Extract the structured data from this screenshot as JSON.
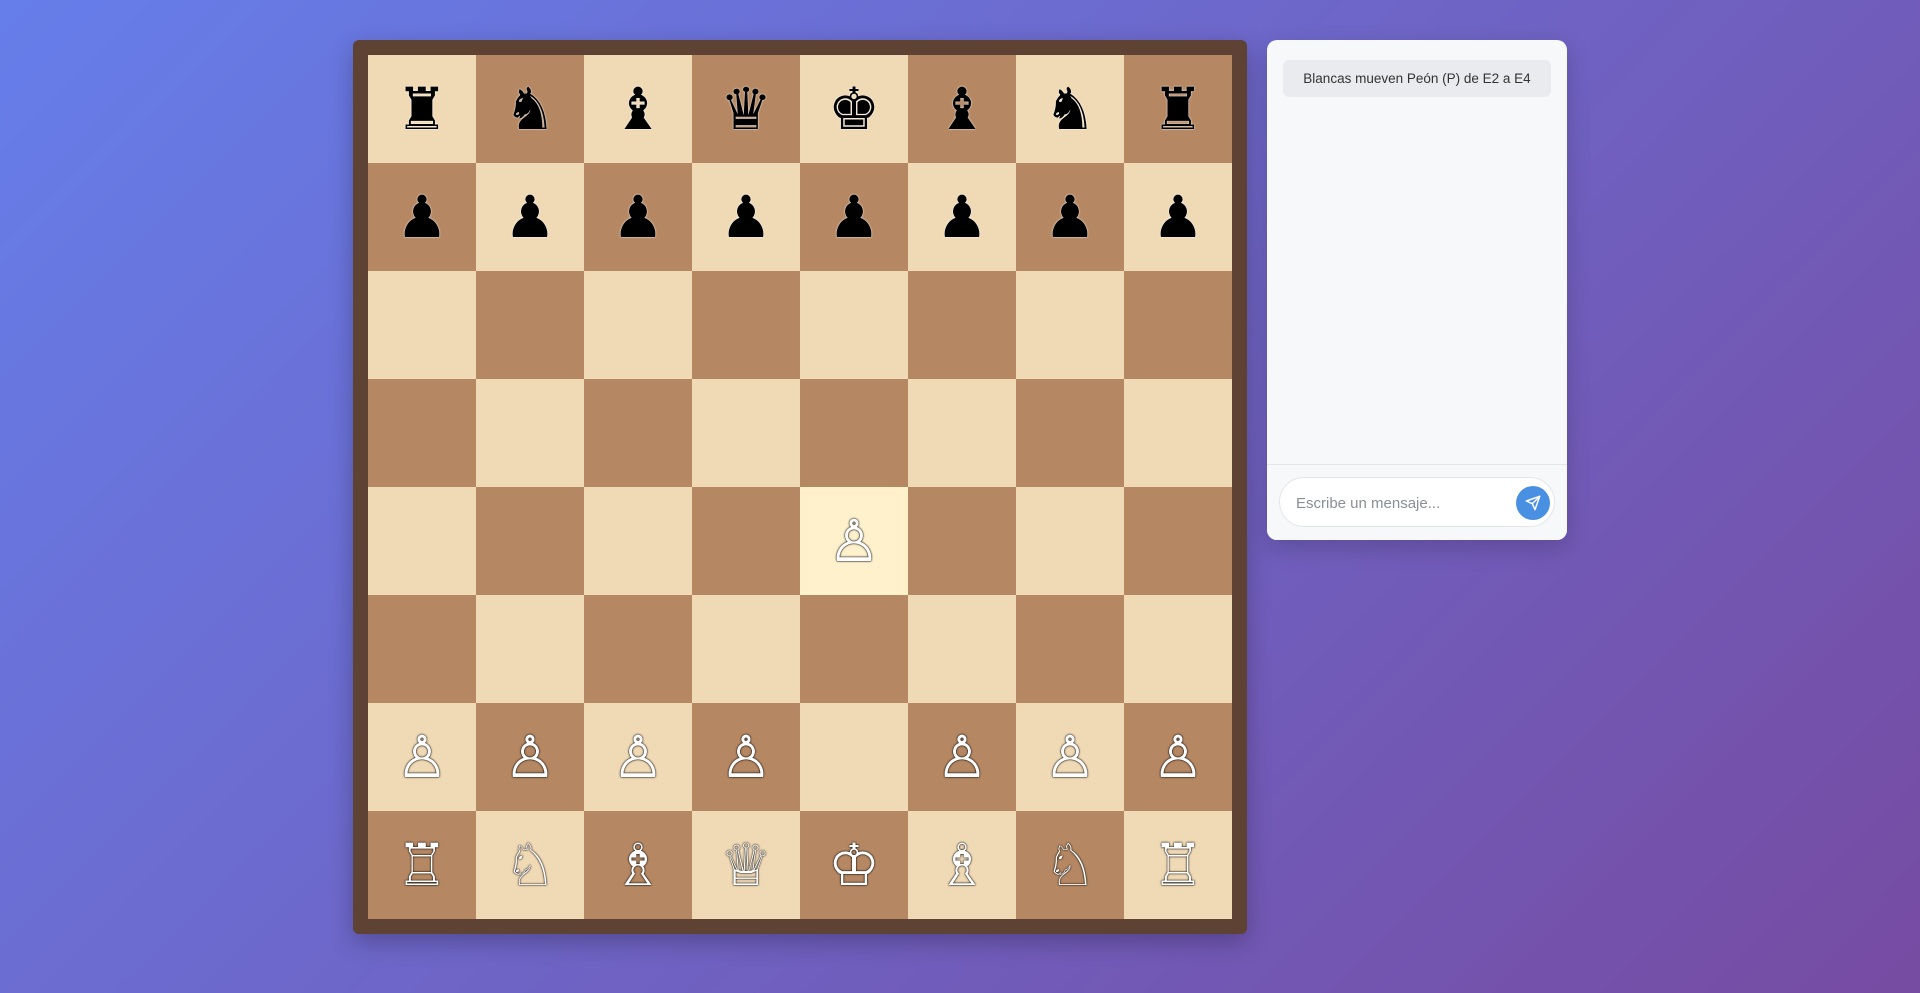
{
  "board": {
    "light_color": "#f0d9b5",
    "dark_color": "#b58863",
    "highlight_color": "#fff1cc",
    "frame_color": "#5e4233",
    "highlighted_squares": [
      "e4"
    ],
    "ranks": [
      [
        "♜",
        "♞",
        "♝",
        "♛",
        "♚",
        "♝",
        "♞",
        "♜"
      ],
      [
        "♟",
        "♟",
        "♟",
        "♟",
        "♟",
        "♟",
        "♟",
        "♟"
      ],
      [
        "",
        "",
        "",
        "",
        "",
        "",
        "",
        ""
      ],
      [
        "",
        "",
        "",
        "",
        "",
        "",
        "",
        ""
      ],
      [
        "",
        "",
        "",
        "",
        "♙",
        "",
        "",
        ""
      ],
      [
        "",
        "",
        "",
        "",
        "",
        "",
        "",
        ""
      ],
      [
        "♙",
        "♙",
        "♙",
        "♙",
        "",
        "♙",
        "♙",
        "♙"
      ],
      [
        "♖",
        "♘",
        "♗",
        "♕",
        "♔",
        "♗",
        "♘",
        "♖"
      ]
    ]
  },
  "chat": {
    "messages": [
      {
        "text": "Blancas mueven Peón (P) de E2 a E4"
      }
    ],
    "input": {
      "placeholder": "Escribe un mensaje...",
      "value": ""
    },
    "send_icon": "send-icon",
    "accent_color": "#4a90e2"
  }
}
